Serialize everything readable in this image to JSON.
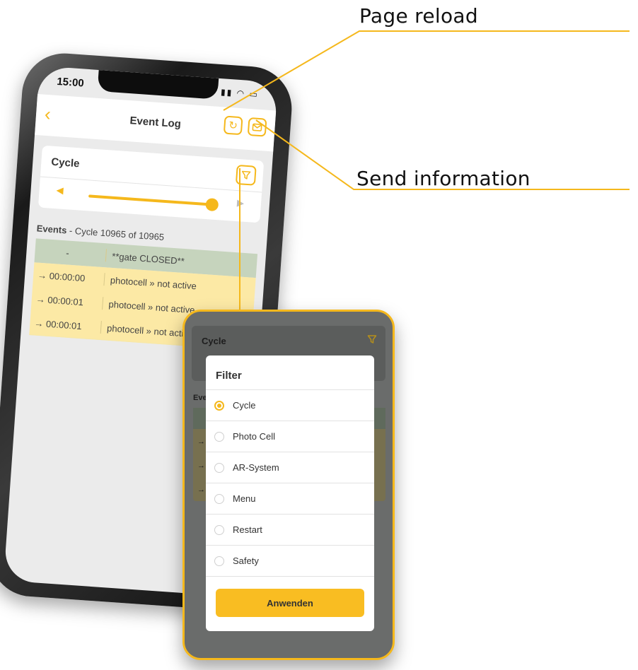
{
  "callouts": {
    "page_reload": "Page reload",
    "send_information": "Send information"
  },
  "status_bar": {
    "time": "15:00",
    "icons": [
      "signal-icon",
      "wifi-icon",
      "battery-icon"
    ]
  },
  "app_header": {
    "title": "Event Log",
    "back_icon": "chevron-left-icon",
    "reload_icon": "reload-icon",
    "mail_icon": "mail-icon"
  },
  "cycle_card": {
    "title": "Cycle",
    "filter_icon": "filter-icon",
    "slider_value_fraction": 1.0
  },
  "events": {
    "label": "Events",
    "subtitle": "- Cycle 10965 of 10965",
    "rows": [
      {
        "time": "-",
        "desc": "**gate CLOSED**",
        "kind": "gate"
      },
      {
        "time": "→ 00:00:00",
        "desc": "photocell » not active",
        "kind": "event"
      },
      {
        "time": "→ 00:00:01",
        "desc": "photocell » not active",
        "kind": "event"
      },
      {
        "time": "→ 00:00:01",
        "desc": "photocell » not activ",
        "kind": "event"
      }
    ]
  },
  "popup": {
    "cycle_title": "Cycle",
    "events_label": "Eve",
    "modal": {
      "title": "Filter",
      "options": [
        {
          "label": "Cycle",
          "selected": true
        },
        {
          "label": "Photo Cell",
          "selected": false
        },
        {
          "label": "AR-System",
          "selected": false
        },
        {
          "label": "Menu",
          "selected": false
        },
        {
          "label": "Restart",
          "selected": false
        },
        {
          "label": "Safety",
          "selected": false
        }
      ],
      "apply_label": "Anwenden"
    }
  },
  "colors": {
    "accent": "#f5b81c",
    "gate_row": "#c6d4bd",
    "event_row": "#fce9a5",
    "popup_bg": "#6a6c6b"
  }
}
